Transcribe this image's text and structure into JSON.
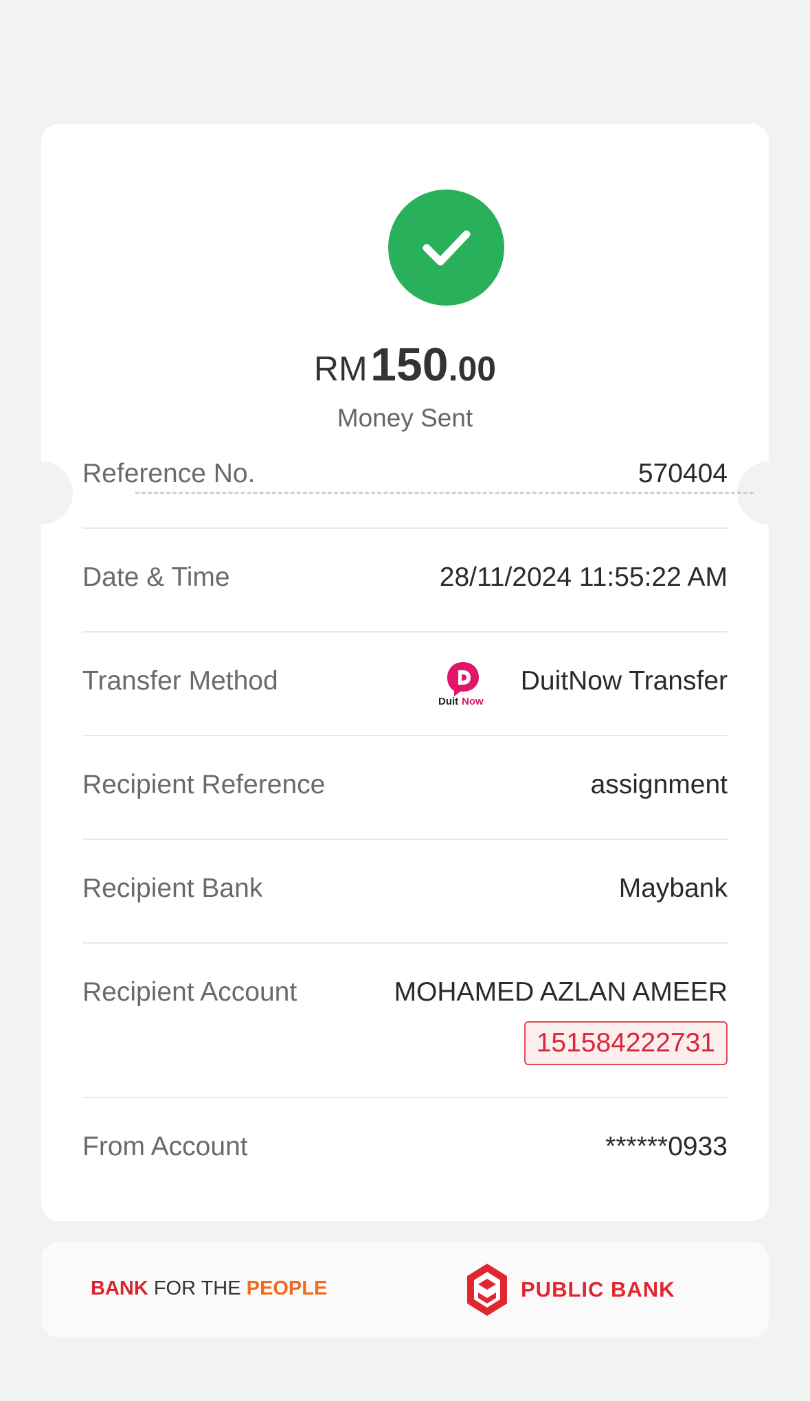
{
  "receipt": {
    "currency": "RM",
    "amount_integer": "150",
    "amount_decimal": ".00",
    "status_label": "Money Sent",
    "status_color": "#29b05a"
  },
  "details": [
    {
      "label": "Reference No.",
      "value": "570404"
    },
    {
      "label": "Date & Time",
      "value": "28/11/2024 11:55:22 AM"
    },
    {
      "label": "Transfer Method",
      "value": "DuitNow Transfer",
      "icon": "duitnow-logo"
    },
    {
      "label": "Recipient Reference",
      "value": "assignment"
    },
    {
      "label": "Recipient Bank",
      "value": "Maybank"
    },
    {
      "label": "Recipient Account",
      "value": "MOHAMED AZLAN AMEER",
      "account_number": "151584222731"
    },
    {
      "label": "From Account",
      "value": "******0933"
    }
  ],
  "footer": {
    "tagline_part1": "BANK",
    "tagline_part2": " FOR THE ",
    "tagline_part3": "PEOPLE",
    "bank_name": "PUBLIC BANK",
    "brand_color": "#e0262f",
    "accent_color": "#f26a1b"
  },
  "duitnow": {
    "logo_text_1": "Duit",
    "logo_text_2": "Now",
    "logo_color": "#e0156b"
  }
}
